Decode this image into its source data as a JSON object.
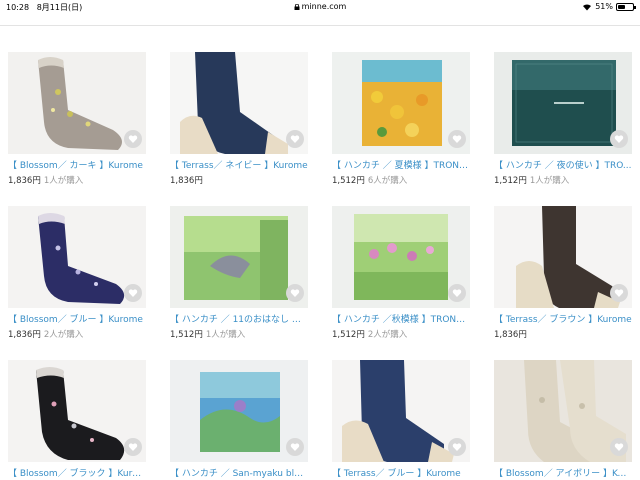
{
  "status": {
    "time": "10:28",
    "date": "8月11日(日)",
    "url": "minne.com",
    "battery": "51%",
    "battery_level": 0.51
  },
  "items": [
    {
      "title": "【 Blossom／ カーキ 】Kurome",
      "price": "1,836円",
      "buyers": "1人が購入"
    },
    {
      "title": "【 Terrass／ ネイビー 】Kurome",
      "price": "1,836円",
      "buyers": ""
    },
    {
      "title": "【 ハンカチ ／ 夏模様 】TRONCHI",
      "price": "1,512円",
      "buyers": "6人が購入"
    },
    {
      "title": "【 ハンカチ ／ 夜の使い 】TRO...",
      "price": "1,512円",
      "buyers": "1人が購入"
    },
    {
      "title": "【 Blossom／ ブルー 】Kurome",
      "price": "1,836円",
      "buyers": "2人が購入"
    },
    {
      "title": "【 ハンカチ ／ 11のおはなし 】T...",
      "price": "1,512円",
      "buyers": "1人が購入"
    },
    {
      "title": "【 ハンカチ ／秋模様 】TRONCHI",
      "price": "1,512円",
      "buyers": "2人が購入"
    },
    {
      "title": "【 Terrass／ ブラウン 】Kurome",
      "price": "1,836円",
      "buyers": ""
    },
    {
      "title": "【 Blossom／ ブラック 】Kurome",
      "price": "",
      "buyers": ""
    },
    {
      "title": "【 ハンカチ ／ San-myaku blue ...",
      "price": "",
      "buyers": ""
    },
    {
      "title": "【 Terrass／ ブルー 】Kurome",
      "price": "",
      "buyers": ""
    },
    {
      "title": "【 Blossom／ アイボリー 】Kurome",
      "price": "",
      "buyers": ""
    }
  ],
  "icons": {
    "favorite": "heart-icon",
    "wifi": "wifi-icon",
    "lock": "lock-icon",
    "battery": "battery-icon"
  }
}
